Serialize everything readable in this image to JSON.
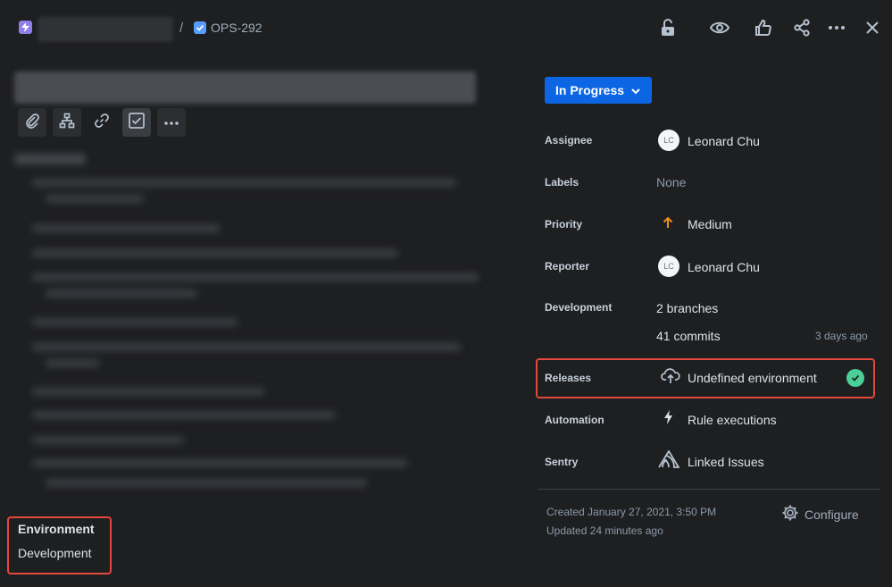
{
  "header": {
    "breadcrumb_sep": "/",
    "issue_key": "OPS-292",
    "icons": [
      "lightning-icon",
      "checkbox-icon",
      "unlock-icon",
      "eye-icon",
      "thumbs-up-icon",
      "share-icon",
      "more-icon",
      "close-icon"
    ]
  },
  "toolbar": {
    "icons": [
      "paperclip-icon",
      "hierarchy-icon",
      "link-icon",
      "checkbox-icon",
      "more-icon"
    ]
  },
  "environment": {
    "label": "Environment",
    "value": "Development"
  },
  "status": {
    "label": "In Progress",
    "color": "#0c66e4"
  },
  "fields": {
    "assignee": {
      "label": "Assignee",
      "initials": "LC",
      "value": "Leonard Chu"
    },
    "labels": {
      "label": "Labels",
      "value": "None"
    },
    "priority": {
      "label": "Priority",
      "value": "Medium",
      "color": "#f18d13"
    },
    "reporter": {
      "label": "Reporter",
      "initials": "LC",
      "value": "Leonard Chu"
    },
    "development": {
      "label": "Development",
      "branches": "2 branches",
      "commits": "41 commits",
      "commits_time": "3 days ago"
    },
    "releases": {
      "label": "Releases",
      "value": "Undefined environment",
      "status_color": "#4bce97"
    },
    "automation": {
      "label": "Automation",
      "value": "Rule executions"
    },
    "sentry": {
      "label": "Sentry",
      "value": "Linked Issues"
    }
  },
  "footer": {
    "created": "Created January 27, 2021, 3:50 PM",
    "updated": "Updated 24 minutes ago",
    "configure": "Configure"
  },
  "highlight_color": "#e2483d"
}
